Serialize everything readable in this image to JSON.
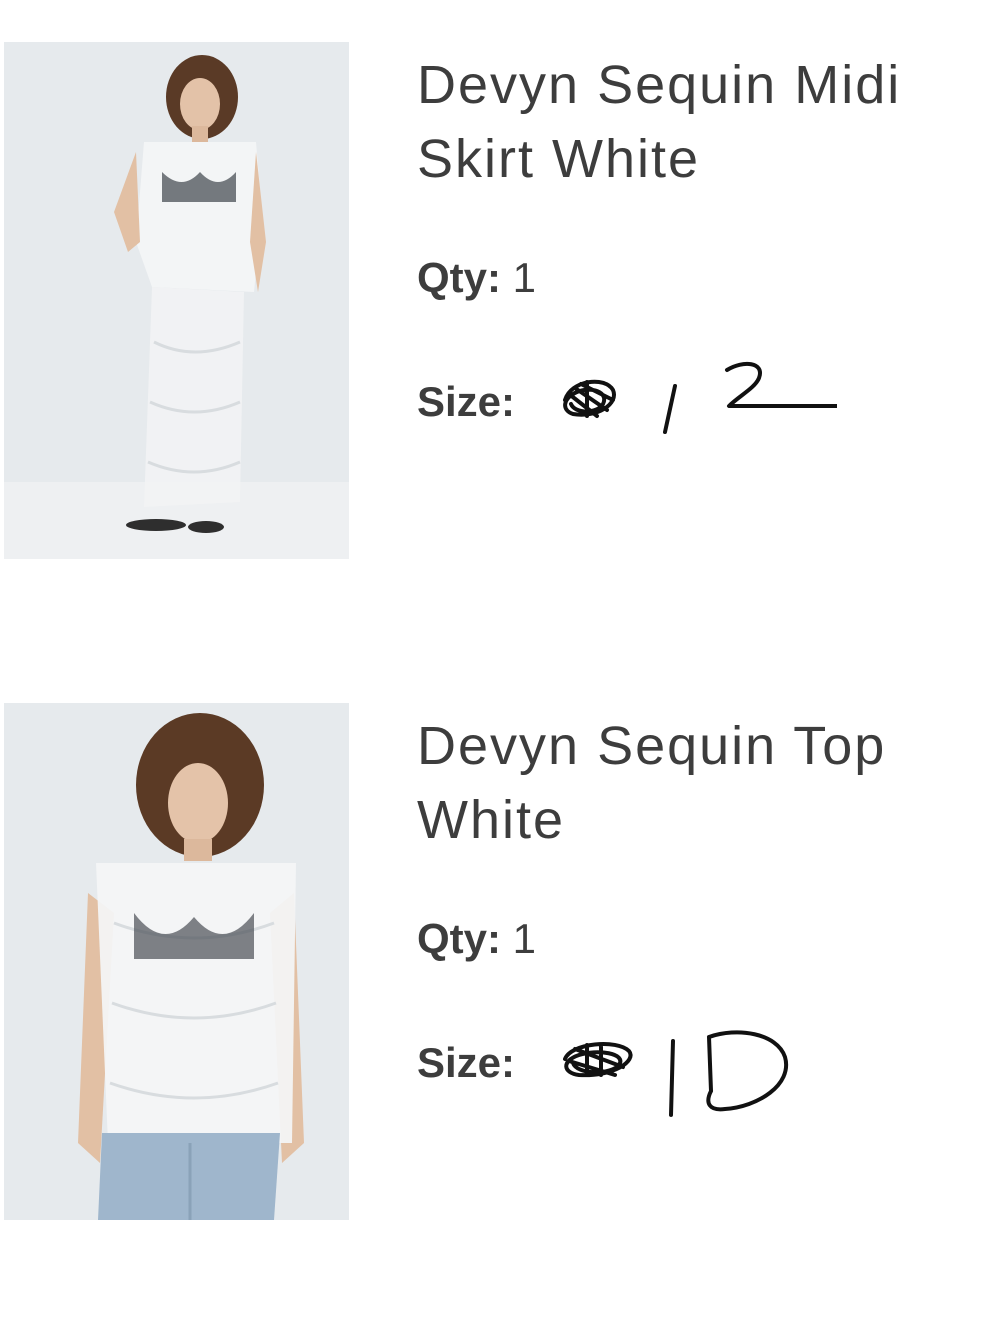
{
  "items": [
    {
      "name": "Devyn Sequin Midi Skirt White",
      "qty_label": "Qty:",
      "qty_value": "1",
      "size_label": "Size:",
      "size_handwritten": "12",
      "image_icon": "product-photo-skirt"
    },
    {
      "name": "Devyn Sequin Top White",
      "qty_label": "Qty:",
      "qty_value": "1",
      "size_label": "Size:",
      "size_handwritten": "10",
      "image_icon": "product-photo-top"
    }
  ]
}
